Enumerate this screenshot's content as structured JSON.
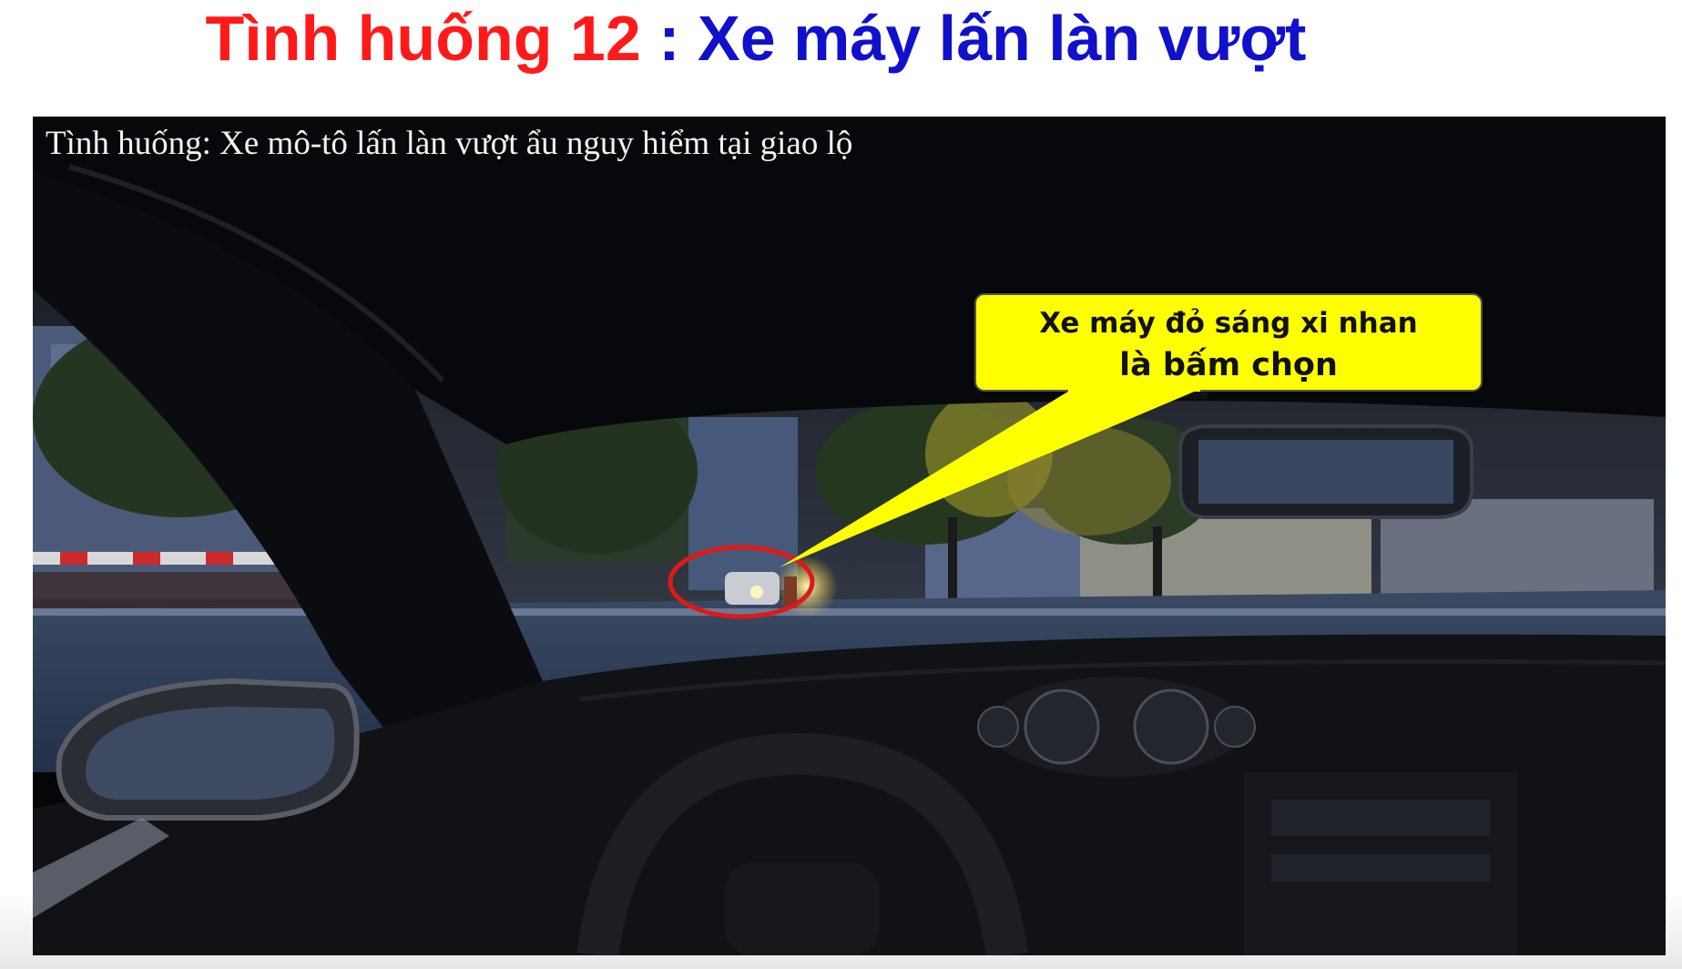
{
  "slide": {
    "title_part1": "Tình huống 12",
    "title_separator": " : ",
    "title_part2": "Xe máy lấn làn vượt"
  },
  "video": {
    "caption": "Tình huống: Xe mô-tô lấn làn vượt ẩu nguy hiểm tại giao lộ",
    "callout_line1": "Xe máy đỏ sáng xi nhan",
    "callout_line2": "là bấm chọn"
  },
  "colors": {
    "title_red": "#ff1a1a",
    "title_blue": "#1111cc",
    "callout_fill": "#ffff00",
    "highlight_ellipse": "#e01818"
  }
}
